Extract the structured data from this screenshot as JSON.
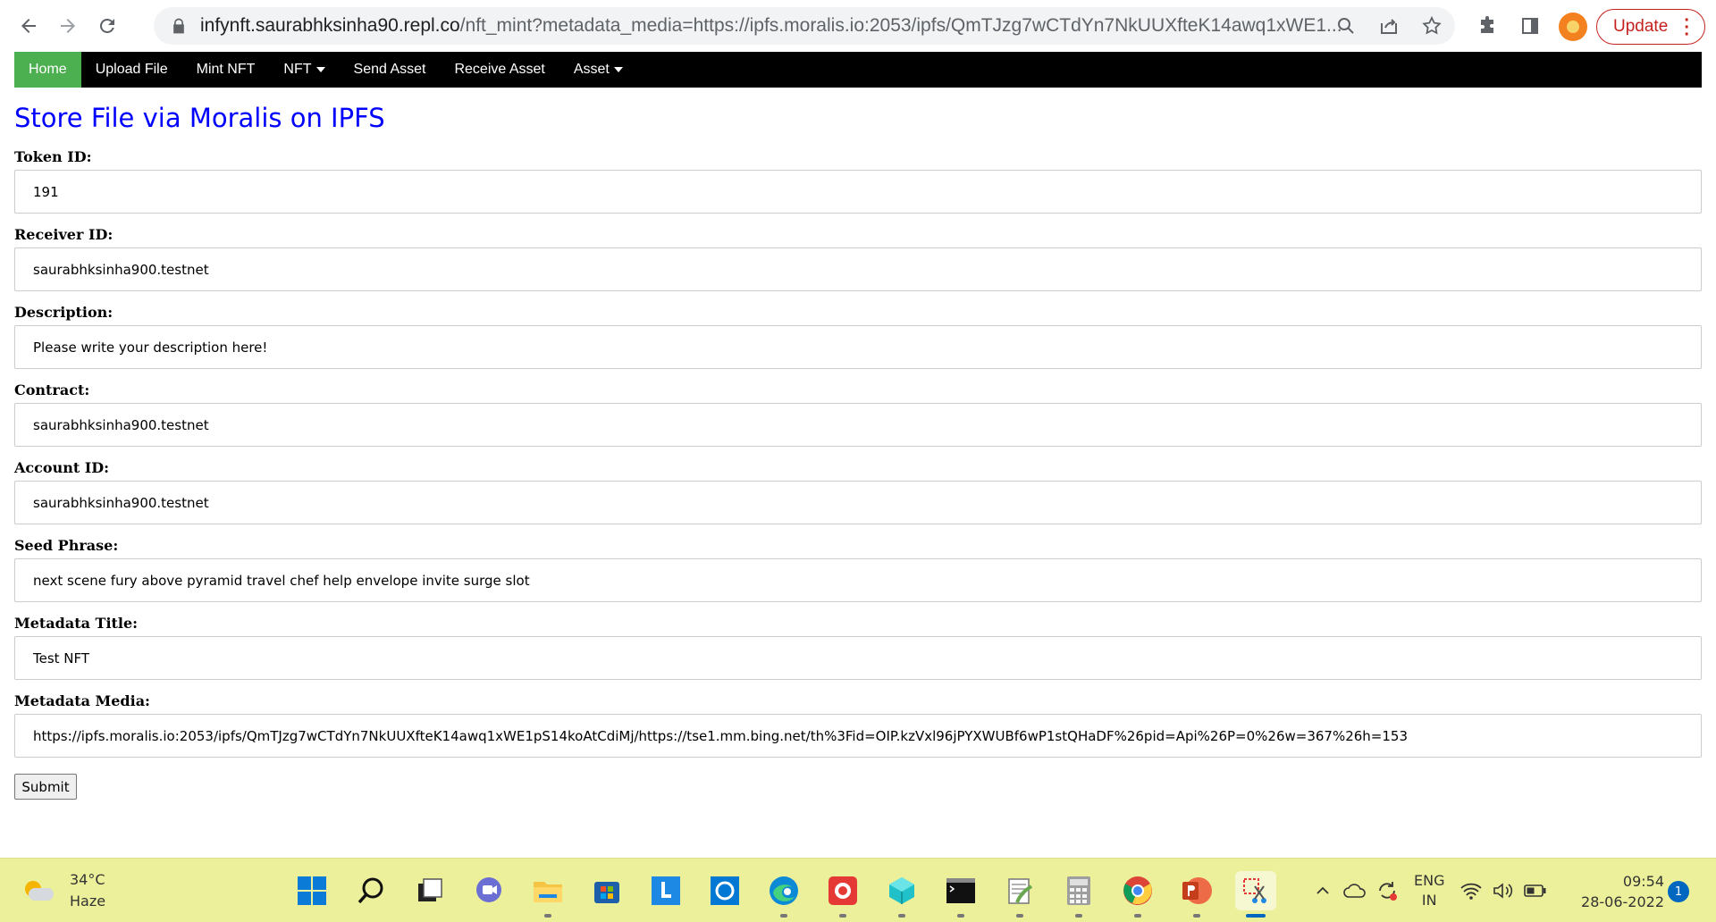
{
  "browser": {
    "url_host": "infynft.saurabhksinha90.repl.co",
    "url_rest": "/nft_mint?metadata_media=https://ipfs.moralis.io:2053/ipfs/QmTJzg7wCTdYn7NkUUXfteK14awq1xWE1...",
    "update_label": "Update"
  },
  "navbar": {
    "items": [
      {
        "label": "Home",
        "active": true
      },
      {
        "label": "Upload File"
      },
      {
        "label": "Mint NFT"
      },
      {
        "label": "NFT",
        "dropdown": true
      },
      {
        "label": "Send Asset"
      },
      {
        "label": "Receive Asset"
      },
      {
        "label": "Asset",
        "dropdown": true
      }
    ]
  },
  "page": {
    "title": "Store File via Moralis on IPFS",
    "fields": [
      {
        "label": "Token ID:",
        "value": "191"
      },
      {
        "label": "Receiver ID:",
        "value": "saurabhksinha900.testnet"
      },
      {
        "label": "Description:",
        "value": "Please write your description here!"
      },
      {
        "label": "Contract:",
        "value": "saurabhksinha900.testnet"
      },
      {
        "label": "Account ID:",
        "value": "saurabhksinha900.testnet"
      },
      {
        "label": "Seed Phrase:",
        "value": "next scene fury above pyramid travel chef help envelope invite surge slot"
      },
      {
        "label": "Metadata Title:",
        "value": "Test NFT"
      },
      {
        "label": "Metadata Media:",
        "value": "https://ipfs.moralis.io:2053/ipfs/QmTJzg7wCTdYn7NkUUXfteK14awq1xWE1pS14koAtCdiMj/https://tse1.mm.bing.net/th%3Fid=OIP.kzVxl96jPYXWUBf6wP1stQHaDF%26pid=Api%26P=0%26w=367%26h=153"
      }
    ],
    "submit_label": "Submit"
  },
  "taskbar": {
    "weather_temp": "34°C",
    "weather_desc": "Haze",
    "lang_top": "ENG",
    "lang_bottom": "IN",
    "time": "09:54",
    "date": "28-06-2022",
    "notification_count": "1"
  }
}
